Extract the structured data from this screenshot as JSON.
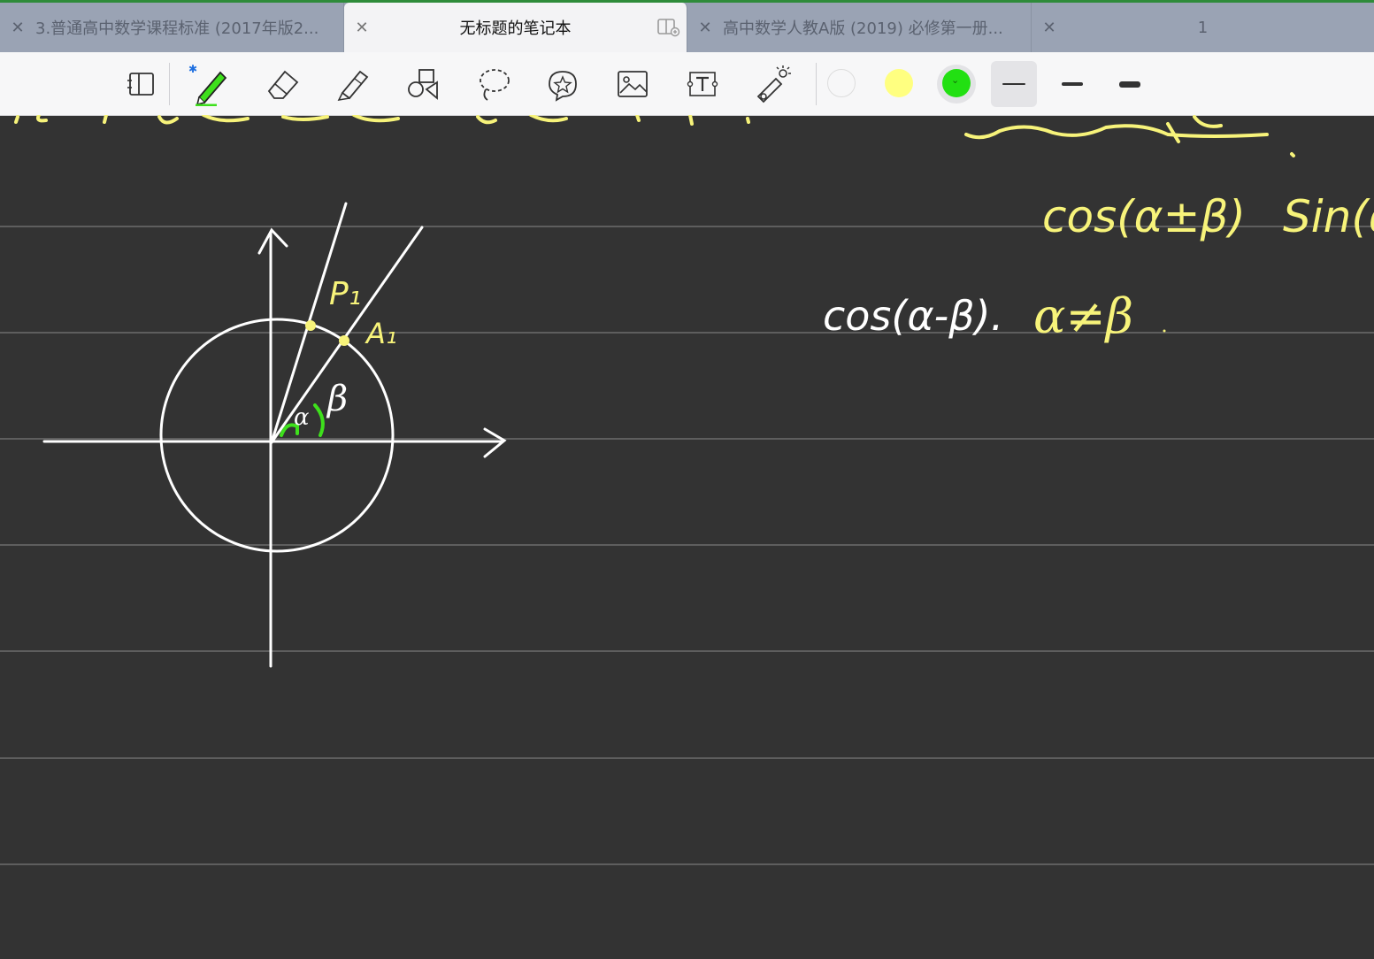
{
  "tabs": [
    {
      "title": "3.普通高中数学课程标准 (2017年版2...",
      "active": false
    },
    {
      "title": "无标题的笔记本",
      "active": true
    },
    {
      "title": "高中数学人教A版 (2019) 必修第一册...",
      "active": false
    },
    {
      "title": "1",
      "active": false
    }
  ],
  "toolbar": {
    "tools": [
      "pages-icon",
      "pen-icon",
      "eraser-icon",
      "highlighter-icon",
      "shapes-icon",
      "lasso-icon",
      "sticker-icon",
      "image-icon",
      "text-box-icon",
      "laser-pointer-icon"
    ],
    "colors": {
      "white": "#ffffff",
      "yellow": "#ffff80",
      "green": "#22e012"
    },
    "selected_color": "green",
    "selected_stroke": "thin"
  },
  "note": {
    "labels": {
      "p1": "P₁",
      "a1": "A₁",
      "alpha": "α",
      "beta": "β"
    },
    "formulas": {
      "top_right_1": "cos(α±β)",
      "top_right_2": "Sin(α",
      "middle_white": "cos(α-β).",
      "middle_yellow": "α≠β"
    },
    "ink_colors": {
      "white": "#ffffff",
      "yellow": "#f7f37a",
      "green": "#3ee01c"
    }
  }
}
